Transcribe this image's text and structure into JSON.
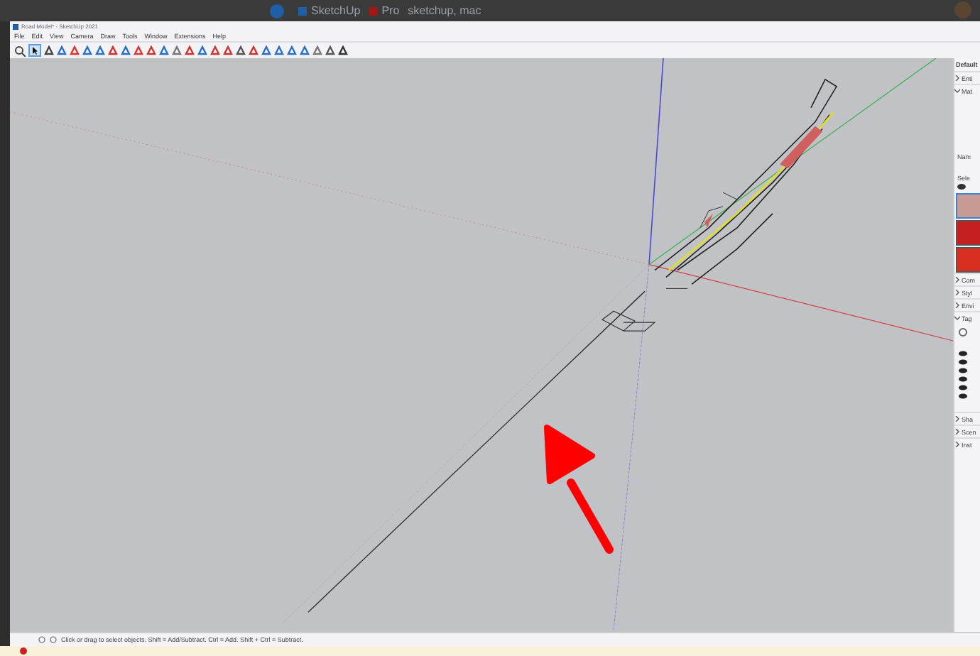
{
  "browser_bar": {
    "tags": [
      {
        "label": "SketchUp",
        "color": "#1f5fa8"
      },
      {
        "label": "Pro",
        "color": "#a01818"
      },
      {
        "label": "sketchup, mac"
      }
    ]
  },
  "window": {
    "title": "Road Model* - SketchUp 2021"
  },
  "menu": [
    "File",
    "Edit",
    "View",
    "Camera",
    "Draw",
    "Tools",
    "Window",
    "Extensions",
    "Help"
  ],
  "tray": {
    "title": "Default",
    "panels": [
      {
        "label": "Enti",
        "expanded": false
      },
      {
        "label": "Mat",
        "expanded": true,
        "name_label": "Nam",
        "select_label": "Sele",
        "swatches": [
          {
            "color": "#c89a94",
            "selected": true
          },
          {
            "color": "#c42020",
            "selected": false
          },
          {
            "color": "#d83020",
            "selected": false
          }
        ]
      },
      {
        "label": "Com",
        "expanded": false
      },
      {
        "label": "Styl",
        "expanded": false
      },
      {
        "label": "Envi",
        "expanded": false
      },
      {
        "label": "Tag",
        "expanded": true,
        "tags": [
          {
            "visible": true
          },
          {
            "visible": true
          },
          {
            "visible": true
          },
          {
            "visible": true
          },
          {
            "visible": true
          },
          {
            "visible": true
          }
        ]
      },
      {
        "label": "Sha",
        "expanded": false
      },
      {
        "label": "Scen",
        "expanded": false
      },
      {
        "label": "Inst",
        "expanded": false
      }
    ]
  },
  "status_bar": {
    "message": "Click or drag to select objects. Shift = Add/Subtract. Ctrl = Add. Shift + Ctrl = Subtract."
  }
}
